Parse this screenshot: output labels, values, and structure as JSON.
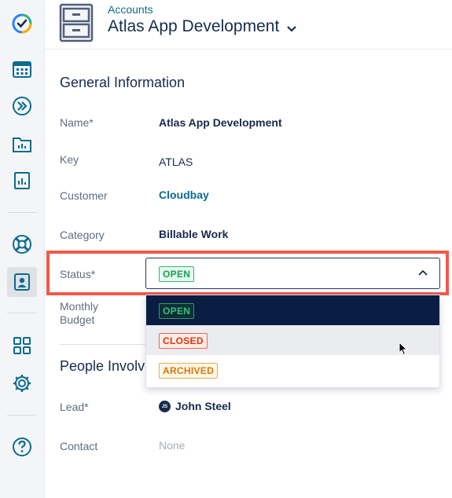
{
  "header": {
    "breadcrumb": "Accounts",
    "title": "Atlas App Development"
  },
  "sidebar": {
    "items": [
      {
        "name": "app-logo-icon"
      },
      {
        "name": "calendar-icon"
      },
      {
        "name": "forward-icon"
      },
      {
        "name": "folder-chart-icon"
      },
      {
        "name": "report-icon"
      },
      {
        "name": "lifebuoy-icon"
      },
      {
        "name": "account-icon",
        "active": true
      },
      {
        "name": "grid-icon"
      },
      {
        "name": "gear-icon"
      },
      {
        "name": "help-icon"
      }
    ]
  },
  "general": {
    "title": "General Information",
    "fields": {
      "name": {
        "label": "Name*",
        "value": "Atlas App Development"
      },
      "key": {
        "label": "Key",
        "value": "ATLAS"
      },
      "customer": {
        "label": "Customer",
        "value": "Cloudbay"
      },
      "category": {
        "label": "Category",
        "value": "Billable Work"
      },
      "status": {
        "label": "Status*",
        "value": "OPEN"
      },
      "budget": {
        "label_line1": "Monthly",
        "label_line2": "Budget"
      }
    }
  },
  "status_options": [
    "OPEN",
    "CLOSED",
    "ARCHIVED"
  ],
  "people": {
    "title": "People Involved",
    "lead": {
      "label": "Lead*",
      "value": "John Steel",
      "initials": "JS"
    },
    "contact": {
      "label": "Contact",
      "value": "None"
    }
  },
  "colors": {
    "accent": "#0b6b8f",
    "highlight": "#ee5a4b",
    "open": "#1f9d57",
    "closed": "#de350b",
    "archived": "#d97706",
    "selected_bg": "#091e42"
  }
}
